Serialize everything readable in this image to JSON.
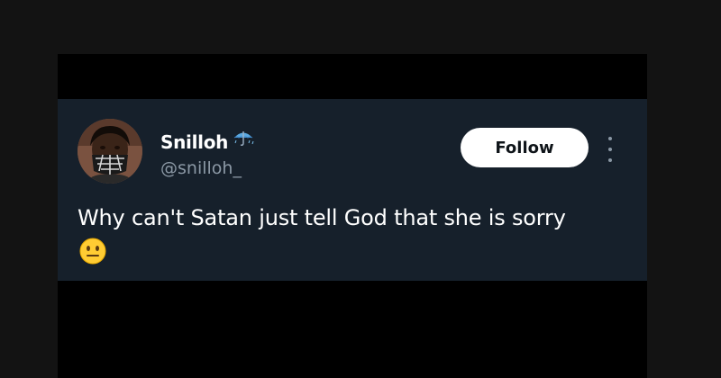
{
  "tweet": {
    "author": {
      "display_name": "Snilloh",
      "handle": "@snilloh_",
      "name_emoji": "umbrella-with-rain-icon",
      "avatar": "avatar"
    },
    "follow_label": "Follow",
    "more_icon": "more-options-icon",
    "text": "Why can't Satan just tell God that she is sorry",
    "emoji": "neutral-face-emoji-icon"
  },
  "colors": {
    "page_background": "#131313",
    "frame_background": "#000000",
    "tweet_background": "#16202b",
    "text_primary": "#ffffff",
    "text_secondary": "#8b98a5",
    "button_background": "#ffffff",
    "button_text": "#0f1419"
  }
}
